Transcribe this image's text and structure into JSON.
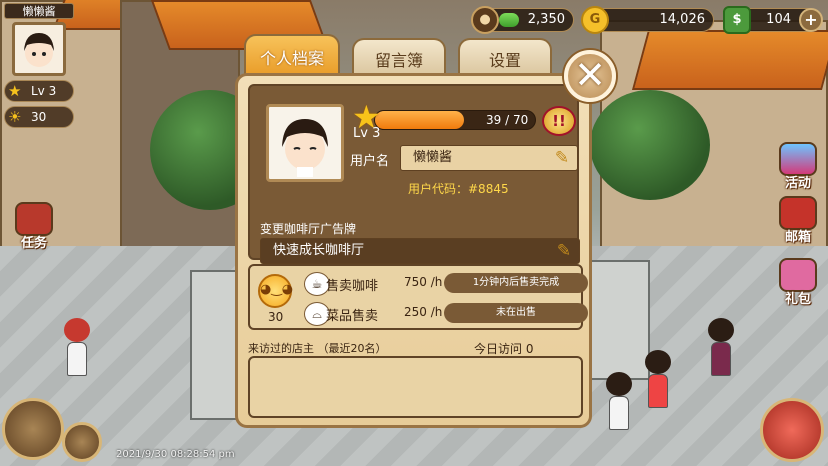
{
  "player": {
    "nickname": "懒懒酱",
    "level_label": "Lv 3",
    "sun_count": "30"
  },
  "resources": {
    "coffee_beans": "2,350",
    "coins": "14,026",
    "cash": "104"
  },
  "side_buttons": {
    "quest_label": "任务",
    "event_label": "活动",
    "mail_label": "邮箱",
    "gift_label": "礼包"
  },
  "timestamp": "2021/9/30 08:28:54 pm",
  "tabs": [
    {
      "label": "个人档案"
    },
    {
      "label": "留言簿"
    },
    {
      "label": "设置"
    }
  ],
  "profile": {
    "level": "Lv 3",
    "xp_text": "39 / 70",
    "xp_fraction": 0.557,
    "username_label": "用户名",
    "username": "懒懒酱",
    "user_code": "用户代码：#8845",
    "sign_label": "变更咖啡厅广告牌",
    "cafe_name": "快速成长咖啡厅",
    "sun_value": "30"
  },
  "stats": [
    {
      "name": "售卖咖啡",
      "rate": "750 /h",
      "status": "1分钟内后售卖完成"
    },
    {
      "name": "菜品售卖",
      "rate": "250 /h",
      "status": "未在出售"
    }
  ],
  "visitors": {
    "title": "来访过的店主 （最近20名）",
    "today": "今日访问 0"
  }
}
